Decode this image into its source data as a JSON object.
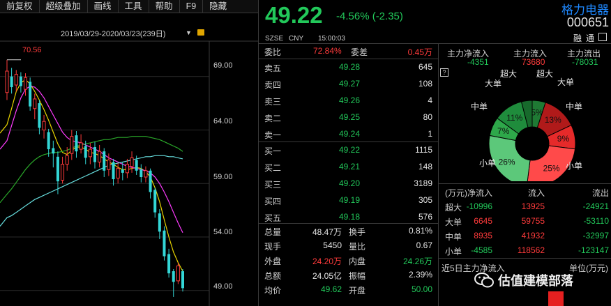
{
  "toolbar": {
    "items": [
      "前复权",
      "超级叠加",
      "画线",
      "工具",
      "帮助",
      "F9",
      "隐藏"
    ]
  },
  "chart": {
    "date_range": "2019/03/29-2020/03/23(239日)",
    "max_label": "70.56",
    "y_ticks": [
      "69.00",
      "64.00",
      "59.00",
      "54.00",
      "49.00"
    ]
  },
  "chart_data": {
    "type": "candlestick",
    "y_range": [
      48.2,
      71.0
    ],
    "y_ticks": [
      69,
      64,
      59,
      54,
      49
    ],
    "max_value": 70.56,
    "candles": [
      [
        67.5,
        69.5,
        66.8,
        70.56,
        "up"
      ],
      [
        69.0,
        68.0,
        67.4,
        69.8,
        "down"
      ],
      [
        68.2,
        69.2,
        67.6,
        69.6,
        "up"
      ],
      [
        69.0,
        68.1,
        67.5,
        69.4,
        "down"
      ],
      [
        67.8,
        68.9,
        67.2,
        69.3,
        "up"
      ],
      [
        68.5,
        66.2,
        65.8,
        68.9,
        "down"
      ],
      [
        66.0,
        66.9,
        65.0,
        67.4,
        "up"
      ],
      [
        66.5,
        64.2,
        63.6,
        66.8,
        "down"
      ],
      [
        64.0,
        64.8,
        63.2,
        65.4,
        "up"
      ],
      [
        63.8,
        62.2,
        61.5,
        64.1,
        "down"
      ],
      [
        62.3,
        61.8,
        60.5,
        63.0,
        "down"
      ],
      [
        61.5,
        59.2,
        58.0,
        62.0,
        "down"
      ],
      [
        59.3,
        60.8,
        59.0,
        61.5,
        "up"
      ],
      [
        60.8,
        61.6,
        60.2,
        62.4,
        "up"
      ],
      [
        61.8,
        63.4,
        61.2,
        64.0,
        "up"
      ],
      [
        63.5,
        62.0,
        61.4,
        63.9,
        "down"
      ],
      [
        62.2,
        62.8,
        61.8,
        63.6,
        "up"
      ],
      [
        62.5,
        61.4,
        60.8,
        63.0,
        "down"
      ],
      [
        61.5,
        62.2,
        60.8,
        62.8,
        "up"
      ],
      [
        62.4,
        61.0,
        60.4,
        62.9,
        "down"
      ],
      [
        61.0,
        62.0,
        60.5,
        62.6,
        "up"
      ],
      [
        62.0,
        60.2,
        59.6,
        62.3,
        "down"
      ],
      [
        60.3,
        61.2,
        59.7,
        61.8,
        "up"
      ],
      [
        61.0,
        59.4,
        58.8,
        61.3,
        "down"
      ],
      [
        59.5,
        60.4,
        59.0,
        60.9,
        "up"
      ],
      [
        60.3,
        60.0,
        59.3,
        61.0,
        "down"
      ],
      [
        60.0,
        60.8,
        59.5,
        61.3,
        "up"
      ],
      [
        60.6,
        61.4,
        60.0,
        62.0,
        "up"
      ],
      [
        61.2,
        60.2,
        59.8,
        61.6,
        "down"
      ],
      [
        60.3,
        59.6,
        59.1,
        60.8,
        "down"
      ],
      [
        59.6,
        60.2,
        59.1,
        60.6,
        "up"
      ],
      [
        60.2,
        58.2,
        57.6,
        60.4,
        "down"
      ],
      [
        58.4,
        56.3,
        55.8,
        58.6,
        "down"
      ],
      [
        56.2,
        54.5,
        53.8,
        56.6,
        "down"
      ],
      [
        54.6,
        52.2,
        51.8,
        55.0,
        "down"
      ],
      [
        52.4,
        50.6,
        50.2,
        52.9,
        "down"
      ],
      [
        50.8,
        49.8,
        48.4,
        51.0,
        "down"
      ],
      [
        49.9,
        51.3,
        49.6,
        51.6,
        "up"
      ],
      [
        50.8,
        49.22,
        48.9,
        51.0,
        "down"
      ]
    ],
    "ma_lines": [
      {
        "color": "#e8d400",
        "values": [
          64.5,
          66.0,
          67.6,
          68.4,
          68.7,
          68.3,
          67.6,
          66.8,
          65.9,
          64.9,
          63.8,
          62.7,
          61.9,
          61.7,
          62.1,
          62.4,
          62.4,
          62.2,
          61.9,
          61.8,
          61.6,
          61.3,
          61.0,
          60.8,
          60.5,
          60.3,
          60.3,
          60.4,
          60.5,
          60.4,
          60.1,
          59.6,
          58.6,
          57.3,
          55.6,
          54.0,
          52.6,
          51.6,
          50.8
        ]
      },
      {
        "color": "#ff3bff",
        "values": [
          63.0,
          64.4,
          65.8,
          67.0,
          67.8,
          68.1,
          68.0,
          67.6,
          67.0,
          66.2,
          65.4,
          64.6,
          63.8,
          63.3,
          63.0,
          62.9,
          62.8,
          62.6,
          62.4,
          62.2,
          62.0,
          61.7,
          61.4,
          61.2,
          61.0,
          60.8,
          60.6,
          60.5,
          60.4,
          60.3,
          60.2,
          60.0,
          59.6,
          59.0,
          58.2,
          57.3,
          56.3,
          55.3,
          54.4
        ]
      },
      {
        "color": "#2aa82a",
        "values": [
          58.0,
          58.5,
          59.1,
          59.7,
          60.3,
          60.8,
          61.2,
          61.5,
          61.7,
          61.8,
          61.9,
          61.9,
          62.0,
          62.1,
          62.3,
          62.5,
          62.6,
          62.7,
          62.8,
          62.9,
          63.0,
          63.1,
          63.1,
          63.2,
          63.3,
          63.3,
          63.3,
          63.4,
          63.4,
          63.4,
          63.4,
          63.3,
          63.2,
          63.1,
          62.9,
          62.7,
          62.5,
          62.3,
          62.0
        ]
      },
      {
        "color": "#66dddd",
        "values": [
          55.8,
          56.0,
          56.3,
          56.6,
          56.9,
          57.2,
          57.5,
          57.7,
          57.9,
          58.1,
          58.3,
          58.5,
          58.7,
          58.9,
          59.1,
          59.3,
          59.5,
          59.7,
          59.9,
          60.1,
          60.3,
          60.5,
          60.7,
          60.8,
          60.9,
          61.0,
          61.1,
          61.2,
          61.3,
          61.4,
          61.5,
          61.5,
          61.6,
          61.6,
          61.6,
          61.5,
          61.5,
          61.4,
          61.3
        ]
      }
    ]
  },
  "quote": {
    "price": "49.22",
    "change": "-4.56% (-2.35)",
    "exchange": "SZSE",
    "currency": "CNY",
    "time": "15:00:03",
    "name": "格力电器",
    "code": "000651",
    "badges": [
      "融",
      "通"
    ]
  },
  "book_header": {
    "weibi_label": "委比",
    "weibi_value": "72.84%",
    "weicha_label": "委差",
    "weicha_value": "0.45万"
  },
  "asks": [
    {
      "label": "卖五",
      "price": "49.28",
      "vol": "645"
    },
    {
      "label": "卖四",
      "price": "49.27",
      "vol": "108"
    },
    {
      "label": "卖三",
      "price": "49.26",
      "vol": "4"
    },
    {
      "label": "卖二",
      "price": "49.25",
      "vol": "80"
    },
    {
      "label": "卖一",
      "price": "49.24",
      "vol": "1"
    }
  ],
  "bids": [
    {
      "label": "买一",
      "price": "49.22",
      "vol": "1115"
    },
    {
      "label": "买二",
      "price": "49.21",
      "vol": "148"
    },
    {
      "label": "买三",
      "price": "49.20",
      "vol": "3189"
    },
    {
      "label": "买四",
      "price": "49.19",
      "vol": "305"
    },
    {
      "label": "买五",
      "price": "49.18",
      "vol": "576"
    }
  ],
  "stats": [
    {
      "l1": "总量",
      "v1": "48.47万",
      "c1": "white",
      "l2": "换手",
      "v2": "0.81%",
      "c2": "white"
    },
    {
      "l1": "现手",
      "v1": "5450",
      "c1": "white",
      "l2": "量比",
      "v2": "0.67",
      "c2": "white"
    },
    {
      "l1": "外盘",
      "v1": "24.20万",
      "c1": "up",
      "l2": "内盘",
      "v2": "24.26万",
      "c2": "down"
    },
    {
      "l1": "总额",
      "v1": "24.05亿",
      "c1": "white",
      "l2": "振幅",
      "v2": "2.39%",
      "c2": "white"
    },
    {
      "l1": "均价",
      "v1": "49.62",
      "c1": "down",
      "l2": "开盘",
      "v2": "50.00",
      "c2": "down"
    }
  ],
  "moneyflow": {
    "net_label": "主力净流入",
    "net_value": "-4351",
    "in_label": "主力流入",
    "in_value": "73680",
    "out_label": "主力流出",
    "out_value": "-78031",
    "help": "?"
  },
  "donut": {
    "segments": [
      {
        "label": "超大",
        "pct": 5,
        "pct_text": "5%",
        "color": "#1f7a34"
      },
      {
        "label": "超大",
        "pct": 13,
        "pct_text": "13%",
        "color": "#b01a1a"
      },
      {
        "label": "大单",
        "pct": 9,
        "pct_text": "9%",
        "color": "#e62a2a"
      },
      {
        "label": "小单",
        "pct": 25,
        "pct_text": "25%",
        "color": "#ff4a4a"
      },
      {
        "label": "小单",
        "pct": 26,
        "pct_text": "26%",
        "color": "#5cc87a"
      },
      {
        "label": "中单",
        "pct": 7,
        "pct_text": "7%",
        "color": "#2ea84a"
      },
      {
        "label": "大单",
        "pct": 11,
        "pct_text": "11%",
        "color": "#1f8c3c"
      },
      {
        "label": "",
        "pct": 4,
        "pct_text": "",
        "color": "#176a2c"
      }
    ],
    "outer_labels": [
      {
        "text": "超大",
        "pos": "a"
      },
      {
        "text": "超大",
        "pos": "b"
      },
      {
        "text": "大单",
        "pos": "c"
      },
      {
        "text": "大单",
        "pos": "d"
      },
      {
        "text": "中单",
        "pos": "e"
      },
      {
        "text": "中单",
        "pos": "f"
      },
      {
        "text": "小单",
        "pos": "g"
      },
      {
        "text": "小单",
        "pos": "h"
      }
    ]
  },
  "flow_table": {
    "headers": [
      "(万元)",
      "净流入",
      "流入",
      "流出"
    ],
    "rows": [
      {
        "name": "超大",
        "net": "-10996",
        "net_c": "down",
        "in": "13925",
        "out": "-24921"
      },
      {
        "name": "大单",
        "net": "6645",
        "net_c": "up",
        "in": "59755",
        "out": "-53110"
      },
      {
        "name": "中单",
        "net": "8935",
        "net_c": "up",
        "in": "41932",
        "out": "-32997"
      },
      {
        "name": "小单",
        "net": "-4585",
        "net_c": "down",
        "in": "118562",
        "out": "-123147"
      }
    ]
  },
  "fiveday": {
    "label": "近5日主力净流入",
    "unit": "单位(万元)"
  },
  "watermark": {
    "text": "估值建模部落"
  }
}
